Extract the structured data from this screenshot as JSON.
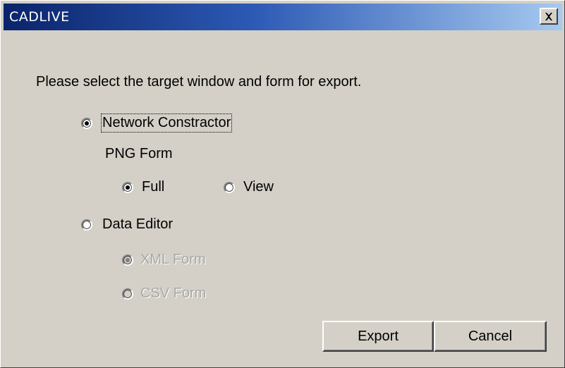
{
  "window": {
    "title": "CADLIVE",
    "close_icon": "close-x-icon"
  },
  "dialog": {
    "prompt": "Please select the target window and form for export.",
    "options": {
      "network_constractor": {
        "label": "Network Constractor",
        "checked": true
      },
      "png_form_label": "PNG Form",
      "full": {
        "label": "Full",
        "checked": true
      },
      "view": {
        "label": "View",
        "checked": false
      },
      "data_editor": {
        "label": "Data Editor",
        "checked": false
      },
      "xml_form": {
        "label": "XML Form",
        "checked": true,
        "disabled": true
      },
      "csv_form": {
        "label": "CSV Form",
        "checked": false,
        "disabled": true
      }
    },
    "buttons": {
      "export": "Export",
      "cancel": "Cancel"
    }
  },
  "colors": {
    "face": "#d4d0c8",
    "title_start": "#0a246a",
    "title_end": "#a6caf0"
  }
}
